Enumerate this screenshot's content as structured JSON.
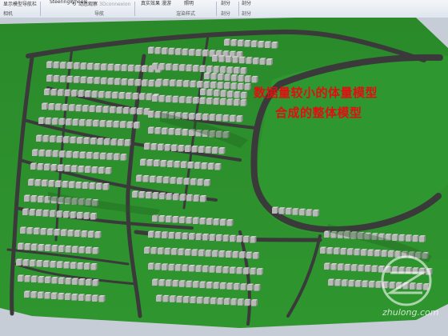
{
  "ribbon": {
    "show_steering": "显示模型导航栏",
    "group_camera": "相机",
    "steering_wheels": "SteeringWheels",
    "dynamic_observe": "动态观察",
    "connexion": "3Dconnexion",
    "group_navigation": "导航",
    "realistic": "真实效果",
    "roam": "漫游",
    "illumination": "照明",
    "group_render_style": "渲染样式",
    "clip_1": "剖分",
    "clip_2": "剖分",
    "group_section_1": "剖分",
    "group_section_2": "剖分"
  },
  "viewport": {
    "caption_line1": "数据量较小的体量模型",
    "caption_line2": "合成的整体模型",
    "watermark_text": "zhulong.com"
  },
  "colors": {
    "terrain": "#2f8a2f",
    "terrain_dark": "#1f5e1f",
    "road": "#3b3b3b",
    "building": "#b9b9b9",
    "caption": "#e01010",
    "sky": "#c6cdd6"
  }
}
